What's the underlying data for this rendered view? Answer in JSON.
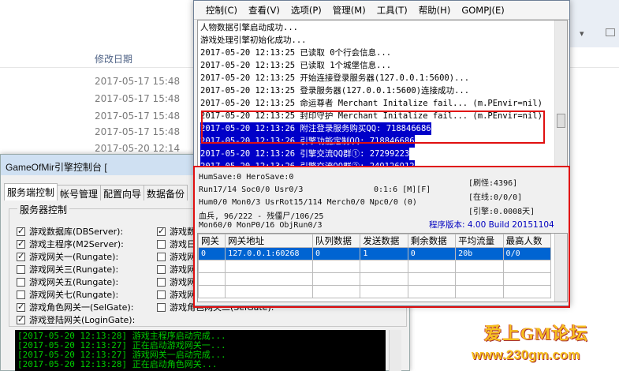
{
  "explorer": {
    "column_header": "修改日期",
    "dates": [
      "2017-05-17 15:48",
      "2017-05-17 15:48",
      "2017-05-17 15:48",
      "2017-05-17 15:48",
      "2017-05-20 12:14"
    ]
  },
  "console": {
    "title": "GameOfMir引擎控制台 [",
    "tabs": [
      "服务端控制",
      "帐号管理",
      "配置向导",
      "数据备份"
    ],
    "group_label": "服务器控制",
    "checks_left": [
      {
        "label": "游戏数据库(DBServer):",
        "checked": true
      },
      {
        "label": "游戏主程序(M2Server):",
        "checked": true
      },
      {
        "label": "游戏网关一(Rungate):",
        "checked": true
      },
      {
        "label": "游戏网关三(Rungate):",
        "checked": false
      },
      {
        "label": "游戏网关五(Rungate):",
        "checked": false
      },
      {
        "label": "游戏网关七(Rungate):",
        "checked": false
      },
      {
        "label": "游戏角色网关一(SelGate):",
        "checked": true
      },
      {
        "label": "游戏登陆网关(LoginGate):",
        "checked": true
      }
    ],
    "checks_right": [
      {
        "label": "游戏数",
        "checked": true
      },
      {
        "label": "游戏日",
        "checked": false
      },
      {
        "label": "游戏网",
        "checked": false
      },
      {
        "label": "游戏网",
        "checked": false
      },
      {
        "label": "游戏网",
        "checked": false
      },
      {
        "label": "游戏网",
        "checked": false
      },
      {
        "label": "游戏角色网关二(SelGate):",
        "checked": false
      }
    ],
    "log": [
      "[2017-05-20 12:13:28] 游戏主程序启动完成...",
      "[2017-05-20 12:13:27] 正在启动游戏网关一...",
      "[2017-05-20 12:13:27] 游戏网关一启动完成...",
      "[2017-05-20 12:13:28] 正在启动角色网关..."
    ]
  },
  "gate": {
    "menu": [
      "控制(C)",
      "查看(V)",
      "选项(P)",
      "管理(M)",
      "工具(T)",
      "帮助(H)",
      "GOMPJ(E)"
    ],
    "log_lines": [
      {
        "text": "人物数据引擎启动成功...",
        "sel": false
      },
      {
        "text": "游戏处理引擎初始化成功...",
        "sel": false
      },
      {
        "text": "2017-05-20 12:13:25 已读取 0个行会信息...",
        "sel": false
      },
      {
        "text": "2017-05-20 12:13:25 已读取 1个城堡信息...",
        "sel": false
      },
      {
        "text": "2017-05-20 12:13:25 开始连接登录服务器(127.0.0.1:5600)...",
        "sel": false
      },
      {
        "text": "2017-05-20 12:13:25 登录服务器(127.0.0.1:5600)连接成功...",
        "sel": false
      },
      {
        "text": "2017-05-20 12:13:25 命运尊者 Merchant Initalize fail... (m.PEnvir=nil)",
        "sel": false
      },
      {
        "text": "2017-05-20 12:13:25 封印守护 Merchant Initalize fail... (m.PEnvir=nil)",
        "sel": false
      },
      {
        "text": "2017-05-20 12:13:26 附注登录服务购买QQ: 718846686",
        "sel": true
      },
      {
        "text": "2017-05-20 12:13:26 引擎功能定制QQ: 718846686",
        "sel": true
      },
      {
        "text": "2017-05-20 12:13:26 引擎交流QQ群①: 27299223",
        "sel": true
      },
      {
        "text": "2017-05-20 12:13:26 引擎交流QQ群②: 249126912",
        "sel": true
      }
    ],
    "stats": {
      "s1": "HumSave:0 HeroSave:0",
      "s2": "Run17/14 Soc0/0 Usr0/3",
      "s2b": "0:1:6 [M][F]",
      "s3": "Hum0/0 Mon0/3 UsrRot15/114 Merch0/0 Npc0/0 (0)",
      "s4": "血兵, 96/222 - 残僵尸/106/25",
      "s5": "Mon60/0 MonP0/16 ObjRun0/3",
      "r1": "[刷怪:4396]",
      "r2": "[在线:0/0/0]",
      "r3": "[引擎:0.0008天]",
      "version": "程序版本: 4.00 Build 20151104"
    },
    "table": {
      "headers": [
        "网关",
        "网关地址",
        "队列数据",
        "发送数据",
        "剩余数据",
        "平均流量",
        "最高人数"
      ],
      "rows": [
        [
          "0",
          "127.0.0.1:60268",
          "0",
          "1",
          "0",
          "20b",
          "0/0"
        ]
      ]
    }
  },
  "watermark": {
    "line1": "爱上GM论坛",
    "line2": "www.230gm.com"
  }
}
